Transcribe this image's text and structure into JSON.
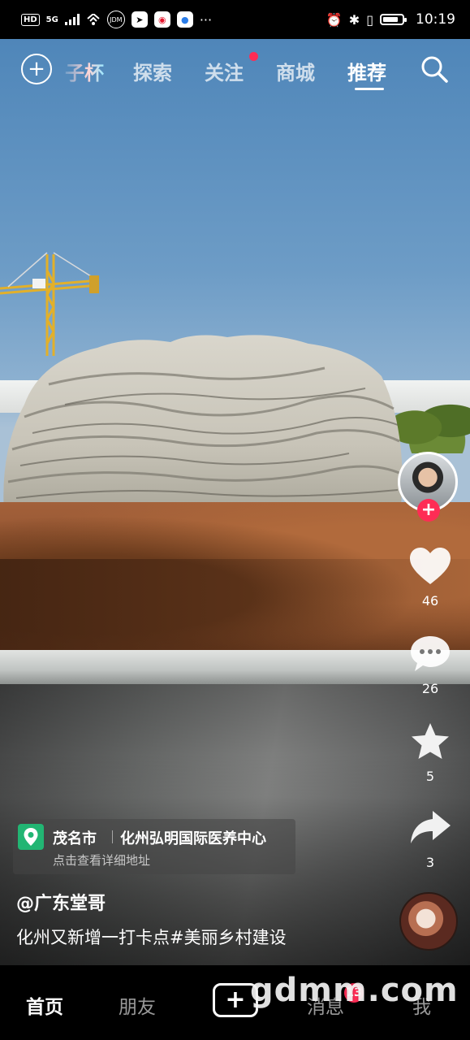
{
  "status_bar": {
    "network": "HD",
    "signal": "5G",
    "time": "10:19",
    "more": "···"
  },
  "top_nav": {
    "cup_label": "子杯",
    "tabs": [
      {
        "label": "探索"
      },
      {
        "label": "关注"
      },
      {
        "label": "商城"
      },
      {
        "label": "推荐"
      }
    ],
    "active_tab": "推荐"
  },
  "rail": {
    "follow_symbol": "+",
    "likes": "46",
    "comments": "26",
    "favorites": "5",
    "shares": "3"
  },
  "location": {
    "city": "茂名市",
    "poi": "化州弘明国际医养中心",
    "hint": "点击查看详细地址"
  },
  "post": {
    "author": "@广东堂哥",
    "caption": "化州又新增一打卡点#美丽乡村建设"
  },
  "bottom_nav": {
    "items": [
      "首页",
      "朋友",
      "消息",
      "我"
    ],
    "create_symbol": "+",
    "message_badge": "13",
    "watermark": "gdmm.com"
  },
  "colors": {
    "accent": "#fe2c55",
    "location_pin": "#22b573"
  }
}
